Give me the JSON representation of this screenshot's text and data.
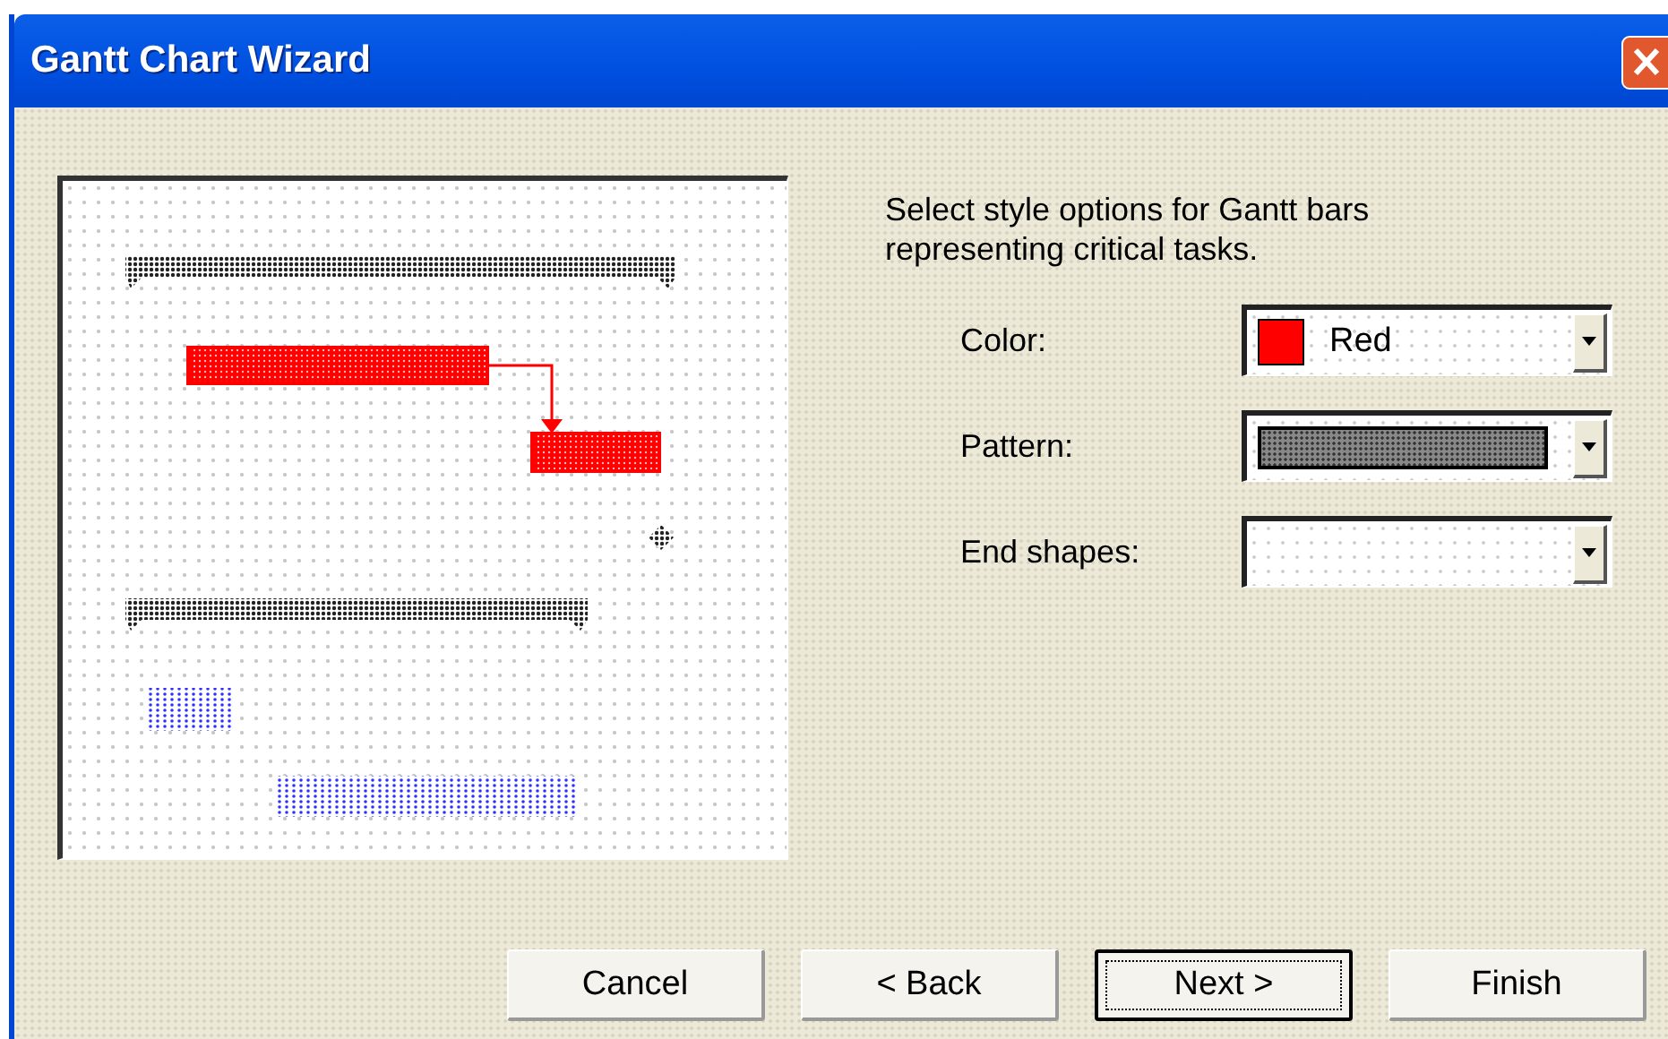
{
  "window": {
    "title": "Gantt Chart Wizard"
  },
  "instructions": "Select style options for Gantt bars representing critical tasks.",
  "fields": [
    {
      "label": "Color:",
      "kind": "color",
      "value": "Red",
      "color": "#ff0000"
    },
    {
      "label": "Pattern:",
      "kind": "pattern"
    },
    {
      "label": "End shapes:",
      "kind": "empty"
    }
  ],
  "buttons": [
    {
      "label": "Cancel",
      "default": false
    },
    {
      "label": "< Back",
      "default": false
    },
    {
      "label": "Next >",
      "default": true
    },
    {
      "label": "Finish",
      "default": false
    }
  ]
}
